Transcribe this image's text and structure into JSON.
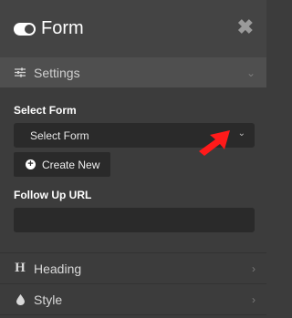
{
  "panel": {
    "title": "Form",
    "close_glyph": "✖",
    "icon": "toggle-icon"
  },
  "settings": {
    "label": "Settings",
    "select_form_label": "Select Form",
    "select_value": "Select Form",
    "create_button": "Create New",
    "followup_label": "Follow Up URL",
    "followup_value": ""
  },
  "sections": [
    {
      "label": "Heading",
      "icon": "H"
    },
    {
      "label": "Style",
      "icon": "droplet-icon"
    }
  ],
  "colors": {
    "pointer": "#ff1a1a",
    "panel_bg": "#3c3c3c",
    "field_bg": "#2a2a2a"
  }
}
